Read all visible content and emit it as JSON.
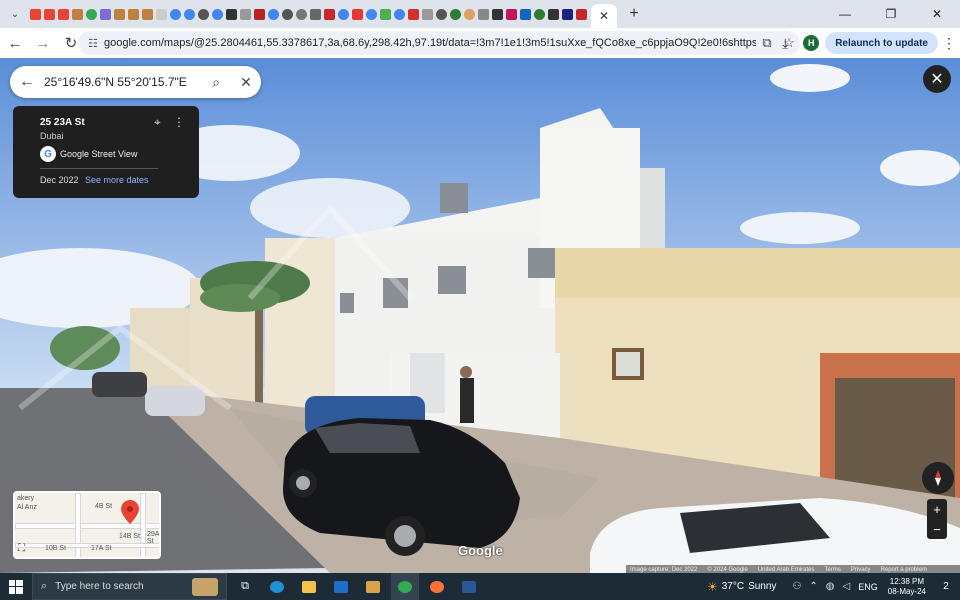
{
  "browser": {
    "url": "google.com/maps/@25.2804461,55.3378617,3a,68.6y,298.42h,97.19t/data=!3m7!1e1!3m5!1suXxe_fQCo8xe_c6ppjaO9Q!2e0!6shttps:%2F%2Fstreetviewpixels-...",
    "relaunch_label": "Relaunch to update",
    "profile_initial": "H",
    "tab_close": "✕",
    "new_tab": "+"
  },
  "search": {
    "value": "25°16'49.6\"N 55°20'15.7\"E"
  },
  "info_card": {
    "street": "25 23A St",
    "city": "Dubai",
    "provider": "Google Street View",
    "date": "Dec 2022",
    "see_more": "See more dates"
  },
  "minimap": {
    "labels": [
      "akery",
      "Al Anz",
      "4B St",
      "14B St",
      "10B St",
      "29A St",
      "17A St"
    ]
  },
  "scene": {
    "watermark": "Google"
  },
  "footer": {
    "capture": "Image capture: Dec 2022",
    "copyright": "© 2024 Google",
    "country": "United Arab Emirates",
    "terms": "Terms",
    "privacy": "Privacy",
    "report": "Report a problem"
  },
  "taskbar": {
    "search_placeholder": "Type here to search",
    "temperature": "37°C",
    "weather": "Sunny",
    "language": "ENG",
    "time": "12:38 PM",
    "date": "08-May-24",
    "notifications": "2"
  },
  "colors": {
    "accent": "#1a73e8",
    "taskbar": "#1c2b36",
    "info_card": "#1f1f1f"
  }
}
